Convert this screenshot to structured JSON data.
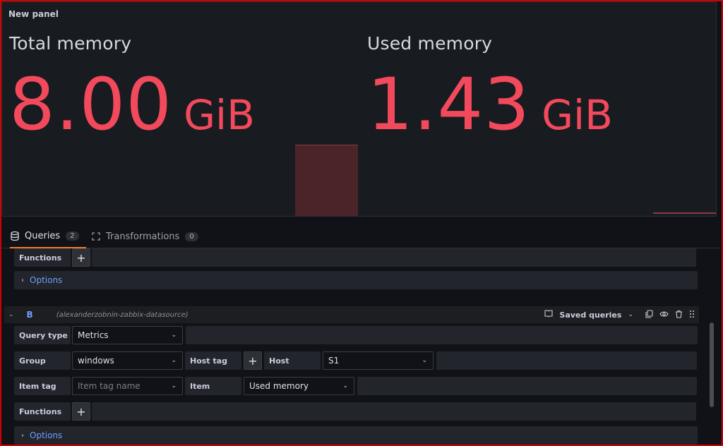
{
  "panel": {
    "title": "New panel",
    "stats": [
      {
        "label": "Total memory",
        "value": "8.00",
        "unit": "GiB"
      },
      {
        "label": "Used memory",
        "value": "1.43",
        "unit": "GiB"
      }
    ]
  },
  "tabs": [
    {
      "label": "Queries",
      "count": "2"
    },
    {
      "label": "Transformations",
      "count": "0"
    }
  ],
  "query_a": {
    "functions_label": "Functions",
    "options_label": "Options"
  },
  "query_b": {
    "name": "B",
    "datasource": "(alexanderzobnin-zabbix-datasource)",
    "saved_queries_label": "Saved queries",
    "query_type_label": "Query type",
    "query_type_value": "Metrics",
    "group_label": "Group",
    "group_value": "windows",
    "host_tag_label": "Host tag",
    "host_label": "Host",
    "host_value": "S1",
    "item_tag_label": "Item tag",
    "item_tag_placeholder": "Item tag name",
    "item_label": "Item",
    "item_value": "Used memory",
    "functions_label": "Functions",
    "options_label": "Options"
  },
  "colors": {
    "stat_value": "#f2495c",
    "active_tab_underline": "#f57c2c",
    "link": "#6e9fff"
  }
}
